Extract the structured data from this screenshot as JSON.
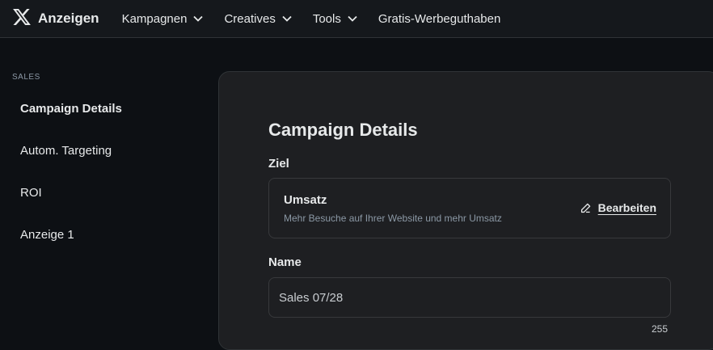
{
  "header": {
    "brand": "Anzeigen",
    "nav": [
      {
        "label": "Kampagnen",
        "has_dropdown": true
      },
      {
        "label": "Creatives",
        "has_dropdown": true
      },
      {
        "label": "Tools",
        "has_dropdown": true
      },
      {
        "label": "Gratis-Werbeguthaben",
        "has_dropdown": false
      }
    ]
  },
  "sidebar": {
    "section_label": "SALES",
    "items": [
      {
        "label": "Campaign Details",
        "active": true
      },
      {
        "label": "Autom. Targeting",
        "active": false
      },
      {
        "label": "ROI",
        "active": false
      },
      {
        "label": "Anzeige 1",
        "active": false
      }
    ]
  },
  "main": {
    "title": "Campaign Details",
    "goal": {
      "label": "Ziel",
      "title": "Umsatz",
      "description": "Mehr Besuche auf Ihrer Website und mehr Umsatz",
      "edit_label": "Bearbeiten"
    },
    "name_field": {
      "label": "Name",
      "value": "Sales 07/28",
      "counter": "255"
    }
  },
  "colors": {
    "topbar_bg": "#15181c",
    "page_bg": "#0d1014",
    "card_bg": "#1e1f22",
    "text": "#e7e9ea",
    "muted_text": "#8b98a5"
  }
}
